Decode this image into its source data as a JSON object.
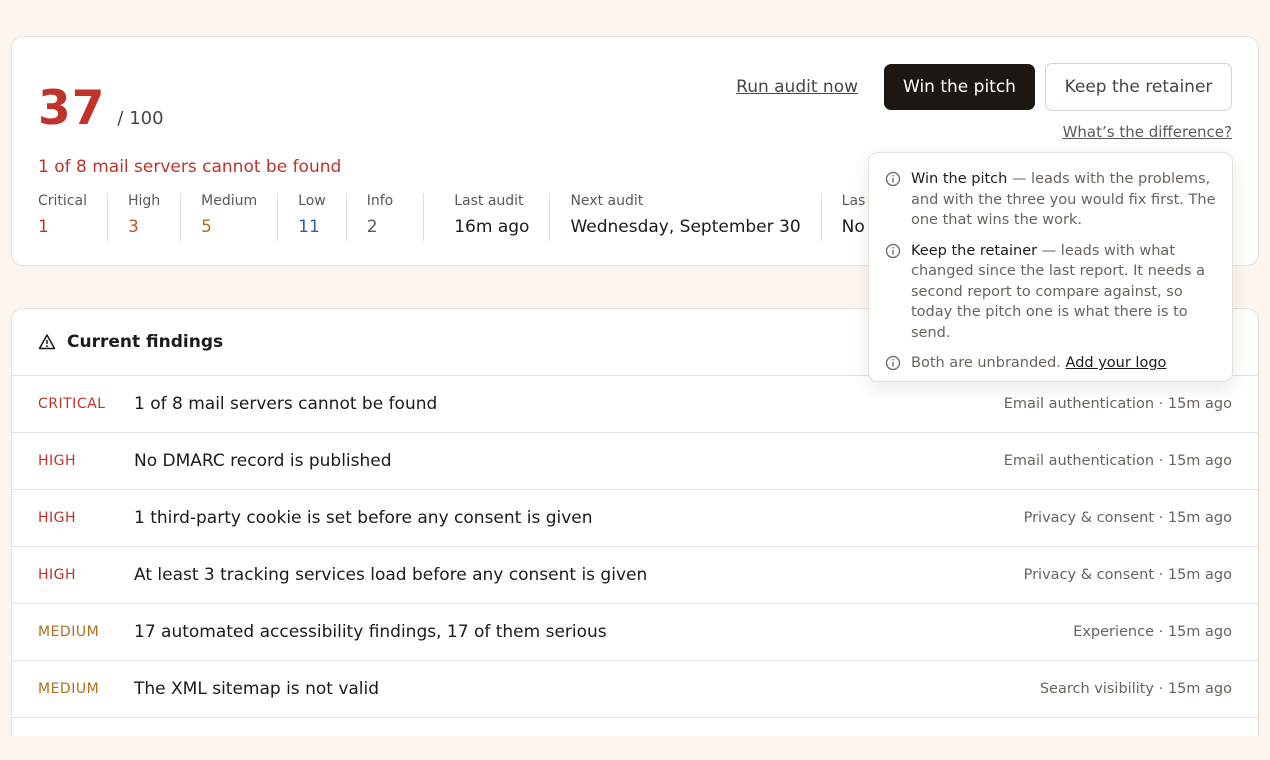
{
  "summary": {
    "score": "37",
    "score_max": "/ 100",
    "alert": "1 of 8 mail servers cannot be found",
    "stats": [
      {
        "label": "Critical",
        "value": "1"
      },
      {
        "label": "High",
        "value": "3"
      },
      {
        "label": "Medium",
        "value": "5"
      },
      {
        "label": "Low",
        "value": "11"
      },
      {
        "label": "Info",
        "value": "2"
      },
      {
        "label": "Last audit",
        "value": "16m ago"
      },
      {
        "label": "Next audit",
        "value": "Wednesday, September 30"
      },
      {
        "label": "Las",
        "value": "No"
      }
    ],
    "actions": {
      "run_audit": "Run audit now",
      "win_pitch": "Win the pitch",
      "keep_retainer": "Keep the retainer",
      "difference": "What’s the difference?"
    }
  },
  "popover": {
    "win_title": "Win the pitch",
    "win_text": " — leads with the problems, and with the three you would fix first. The one that wins the work.",
    "keep_title": "Keep the retainer",
    "keep_text": " — leads with what changed since the last report. It needs a second report to compare against, so today the pitch one is what there is to send.",
    "unbranded_text": "Both are unbranded. ",
    "logo_link": "Add your logo"
  },
  "findings": {
    "title": "Current findings",
    "rows": [
      {
        "severity": "CRITICAL",
        "text": "1 of 8 mail servers cannot be found",
        "meta": "Email authentication · 15m ago"
      },
      {
        "severity": "HIGH",
        "text": "No DMARC record is published",
        "meta": "Email authentication · 15m ago"
      },
      {
        "severity": "HIGH",
        "text": "1 third-party cookie is set before any consent is given",
        "meta": "Privacy & consent · 15m ago"
      },
      {
        "severity": "HIGH",
        "text": "At least 3 tracking services load before any consent is given",
        "meta": "Privacy & consent · 15m ago"
      },
      {
        "severity": "MEDIUM",
        "text": "17 automated accessibility findings, 17 of them serious",
        "meta": "Experience · 15m ago"
      },
      {
        "severity": "MEDIUM",
        "text": "The XML sitemap is not valid",
        "meta": "Search visibility · 15m ago"
      }
    ]
  },
  "colors": {
    "critical": "#c0332b",
    "high": "#c4502a",
    "medium": "#b0701e",
    "low": "#2a62a8",
    "primary_button": "#1d1713",
    "background": "#fdf6f0"
  },
  "icons": {
    "findings_header": "warning-triangle-icon",
    "popover_items": "info-circle-icon"
  }
}
